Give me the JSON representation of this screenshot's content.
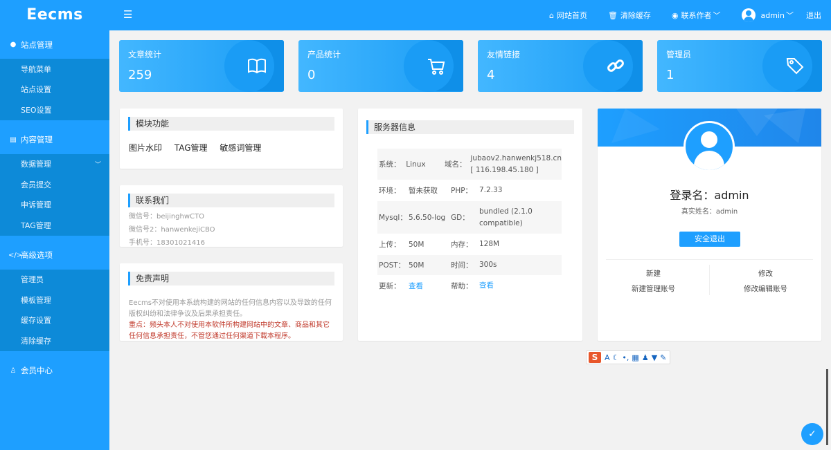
{
  "sidebar": {
    "logo": "Eecms",
    "groups": [
      {
        "title": "站点管理",
        "icon": "globe-icon",
        "items": [
          "导航菜单",
          "站点设置",
          "SEO设置"
        ]
      },
      {
        "title": "内容管理",
        "icon": "document-icon",
        "items": [
          "数据管理",
          "会员提交",
          "申诉管理",
          "TAG管理"
        ]
      },
      {
        "title": "高级选项",
        "icon": "code-icon",
        "items": [
          "管理员",
          "模板管理",
          "缓存设置",
          "清除缓存"
        ]
      },
      {
        "title": "会员中心",
        "icon": "user-icon",
        "items": []
      }
    ]
  },
  "header": {
    "home": "网站首页",
    "clear_cache": "清除缓存",
    "contact_author": "联系作者",
    "username": "admin",
    "logout": "退出"
  },
  "stats": [
    {
      "label": "文章统计",
      "value": "259",
      "icon": "book-icon"
    },
    {
      "label": "产品统计",
      "value": "0",
      "icon": "cart-icon"
    },
    {
      "label": "友情链接",
      "value": "4",
      "icon": "link-icon"
    },
    {
      "label": "管理员",
      "value": "1",
      "icon": "tag-icon"
    }
  ],
  "modules": {
    "title": "模块功能",
    "links": [
      "图片水印",
      "TAG管理",
      "敏感词管理"
    ]
  },
  "contact": {
    "title": "联系我们",
    "lines": [
      "微信号：beijinghwCTO",
      "微信号2：hanwenkejiCBO",
      "手机号：18301021416"
    ]
  },
  "disclaimer": {
    "title": "免责声明",
    "text": "Eecms不对使用本系统构建的网站的任何信息内容以及导致的任何版权纠纷和法律争议及后果承担责任。",
    "red": "重点：频头本人不对使用本软件所构建网站中的文章、商品和其它任何信息承担责任，不管您通过任何渠道下载本程序。"
  },
  "server": {
    "title": "服务器信息",
    "rows": [
      {
        "k1": "系统：",
        "v1": "Linux",
        "k2": "域名：",
        "v2": "jubaov2.hanwenkj518.cn [ 116.198.45.180 ]"
      },
      {
        "k1": "环境：",
        "v1": "暂未获取",
        "k2": "PHP：",
        "v2": "7.2.33"
      },
      {
        "k1": "Mysql：",
        "v1": "5.6.50-log",
        "k2": "GD：",
        "v2": "bundled (2.1.0 compatible)"
      },
      {
        "k1": "上传：",
        "v1": "50M",
        "k2": "内存：",
        "v2": "128M"
      },
      {
        "k1": "POST：",
        "v1": "50M",
        "k2": "时间：",
        "v2": "300s"
      },
      {
        "k1": "更新：",
        "v1": "查看",
        "k2": "帮助：",
        "v2": "查看"
      }
    ]
  },
  "profile": {
    "login_name": "登录名：admin",
    "real_name": "真实姓名：admin",
    "safe_logout": "安全退出",
    "new_title": "新建",
    "new_desc": "新建管理账号",
    "edit_title": "修改",
    "edit_desc": "修改编辑账号"
  },
  "colors": {
    "primary": "#1e9fff",
    "sidebar_sub": "#0d8ad8",
    "red": "#c0392b"
  }
}
